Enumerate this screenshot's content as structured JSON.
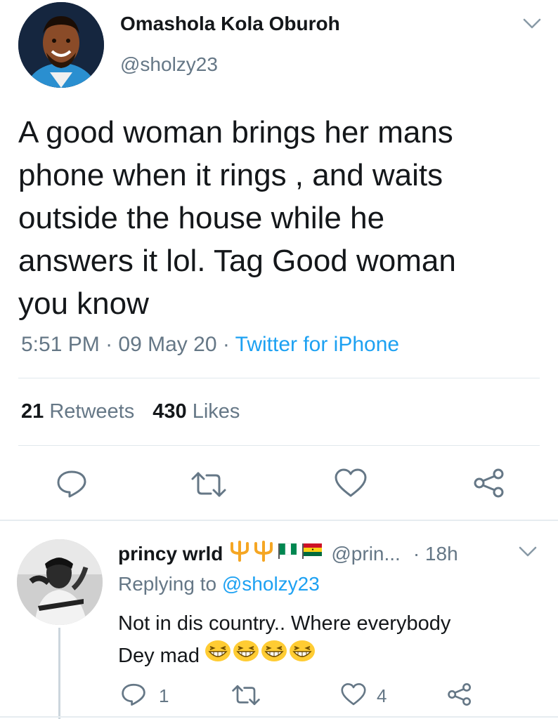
{
  "main_tweet": {
    "author_name": "Omashola Kola Oburoh",
    "author_handle": "@sholzy23",
    "text_lines": [
      "A good woman brings her mans",
      "phone when it rings , and waits",
      "outside the house while he",
      "answers it lol. Tag Good woman",
      "you know"
    ],
    "time": "5:51 PM",
    "dot1": "·",
    "date": "09 May 20",
    "dot2": "·",
    "source": "Twitter for iPhone",
    "stats": {
      "retweets_count": "21",
      "retweets_label": "Retweets",
      "likes_count": "430",
      "likes_label": "Likes"
    },
    "actions": {
      "reply_icon": "reply-icon",
      "retweet_icon": "retweet-icon",
      "like_icon": "heart-icon",
      "share_icon": "share-icon"
    }
  },
  "reply_tweet": {
    "author_name": "princy wrld",
    "emoji_icons": [
      "trident-icon",
      "trident-icon",
      "nigeria-flag-icon",
      "ghana-flag-icon"
    ],
    "handle": "@prin...",
    "time": "· 18h",
    "replying_prefix": "Replying to",
    "replying_to": "@sholzy23",
    "text_line1": "Not in dis country.. Where everybody",
    "text_line2": "Dey mad",
    "laugh_emojis": [
      "grinning-squint-icon",
      "grinning-squint-icon",
      "grinning-squint-icon",
      "grinning-squint-icon"
    ],
    "reply_count": "1",
    "like_count": "4"
  },
  "colors": {
    "accent": "#1da1f2",
    "muted": "#657786",
    "text": "#14171a",
    "divider": "#e1e8ed"
  }
}
